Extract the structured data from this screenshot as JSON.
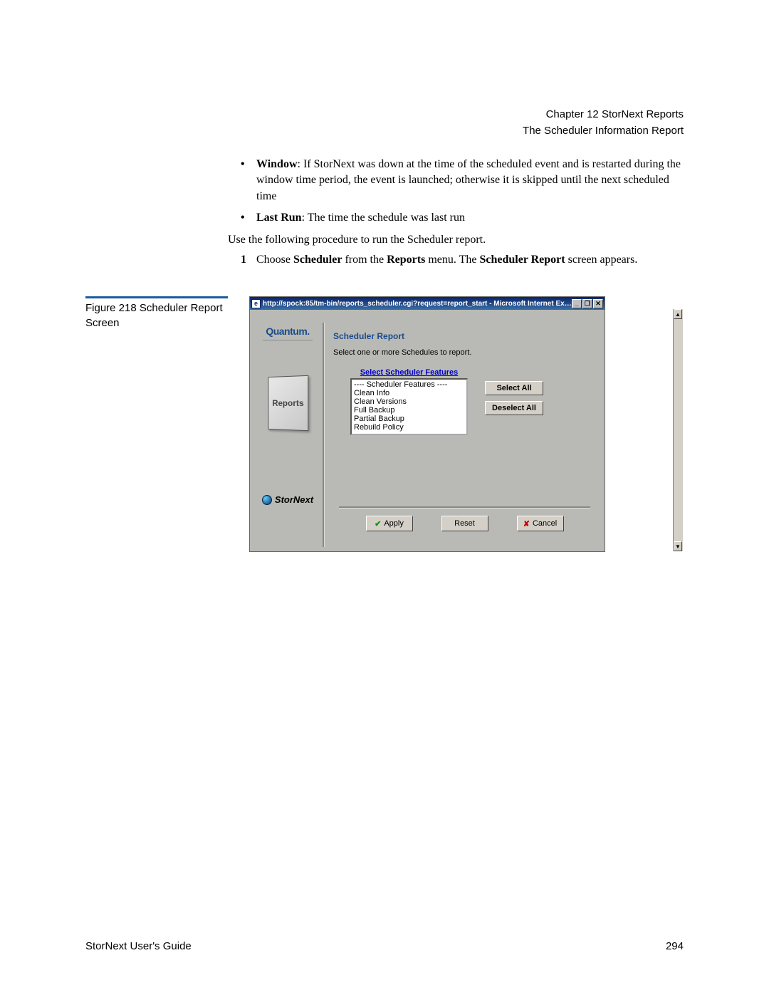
{
  "header": {
    "chapter_line": "Chapter 12  StorNext Reports",
    "section_line": "The Scheduler Information Report"
  },
  "body": {
    "bullets": [
      {
        "lead": "Window",
        "rest": ": If StorNext was down at the time of the scheduled event and is restarted during the window time period, the event is launched; otherwise it is skipped until the next scheduled time"
      },
      {
        "lead": "Last Run",
        "rest": ": The time the schedule was last run"
      }
    ],
    "intro": "Use the following procedure to run the Scheduler report.",
    "step": {
      "num": "1",
      "pre": "Choose ",
      "b1": "Scheduler",
      "mid": " from the ",
      "b2": "Reports",
      "post": " menu. The ",
      "b3": "Scheduler Report",
      "tail": " screen appears."
    }
  },
  "figure": {
    "caption": "Figure 218  Scheduler Report Screen"
  },
  "screenshot": {
    "titlebar_url": "http://spock:85/tm-bin/reports_scheduler.cgi?request=report_start - Microsoft Internet Explo...",
    "wincontrols": {
      "min": "_",
      "restore": "❐",
      "close": "✕"
    },
    "scroll": {
      "up": "▲",
      "down": "▼"
    },
    "sidebar": {
      "brand": "Quantum.",
      "reports": "Reports",
      "product": "StorNext"
    },
    "panel": {
      "title": "Scheduler Report",
      "subtitle": "Select one or more Schedules to report.",
      "list_label": "Select Scheduler Features",
      "options": [
        "---- Scheduler Features ----",
        "Clean Info",
        "Clean Versions",
        "Full Backup",
        "Partial Backup",
        "Rebuild Policy"
      ],
      "select_all": "Select All",
      "deselect_all": "Deselect All"
    },
    "actions": {
      "apply": "Apply",
      "reset": "Reset",
      "cancel": "Cancel"
    }
  },
  "footer": {
    "left": "StorNext User's Guide",
    "right": "294"
  }
}
